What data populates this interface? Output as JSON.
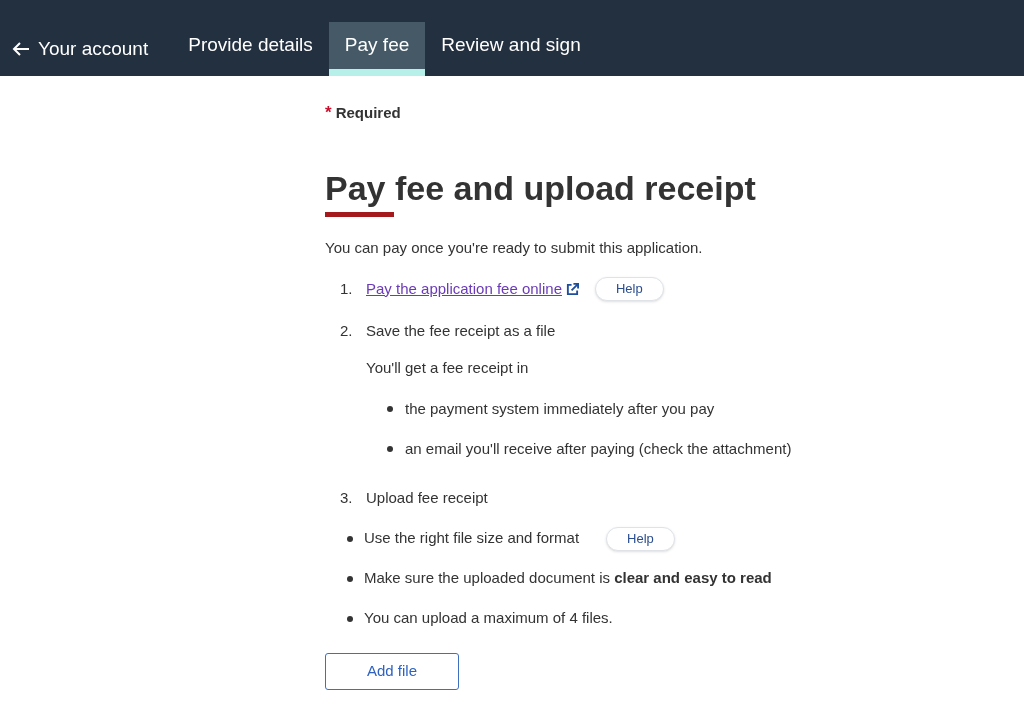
{
  "nav": {
    "back": {
      "label": "Your account"
    },
    "tabs": [
      {
        "label": "Provide details",
        "selected": false
      },
      {
        "label": "Pay fee",
        "selected": true
      },
      {
        "label": "Review and sign",
        "selected": false
      }
    ]
  },
  "required": {
    "mark": "*",
    "label": "Required"
  },
  "heading": "Pay fee and upload receipt",
  "intro": "You can pay once you're ready to submit this application.",
  "steps": [
    {
      "number": "1.",
      "link": "Pay the application fee online",
      "help": "Help"
    },
    {
      "number": "2.",
      "text": "Save the fee receipt as a file",
      "note": "You'll get a fee receipt in",
      "bullets": [
        "the payment system immediately after you pay",
        "an email you'll receive after paying (check the attachment)"
      ]
    },
    {
      "number": "3.",
      "text": "Upload fee receipt"
    }
  ],
  "requirements": [
    {
      "text": "Use the right file size and format",
      "help": "Help"
    },
    {
      "text": "Make sure the uploaded document is **clear and easy to read**"
    },
    {
      "text": "You can upload a maximum of 4 files."
    }
  ],
  "add_button": "Add file"
}
